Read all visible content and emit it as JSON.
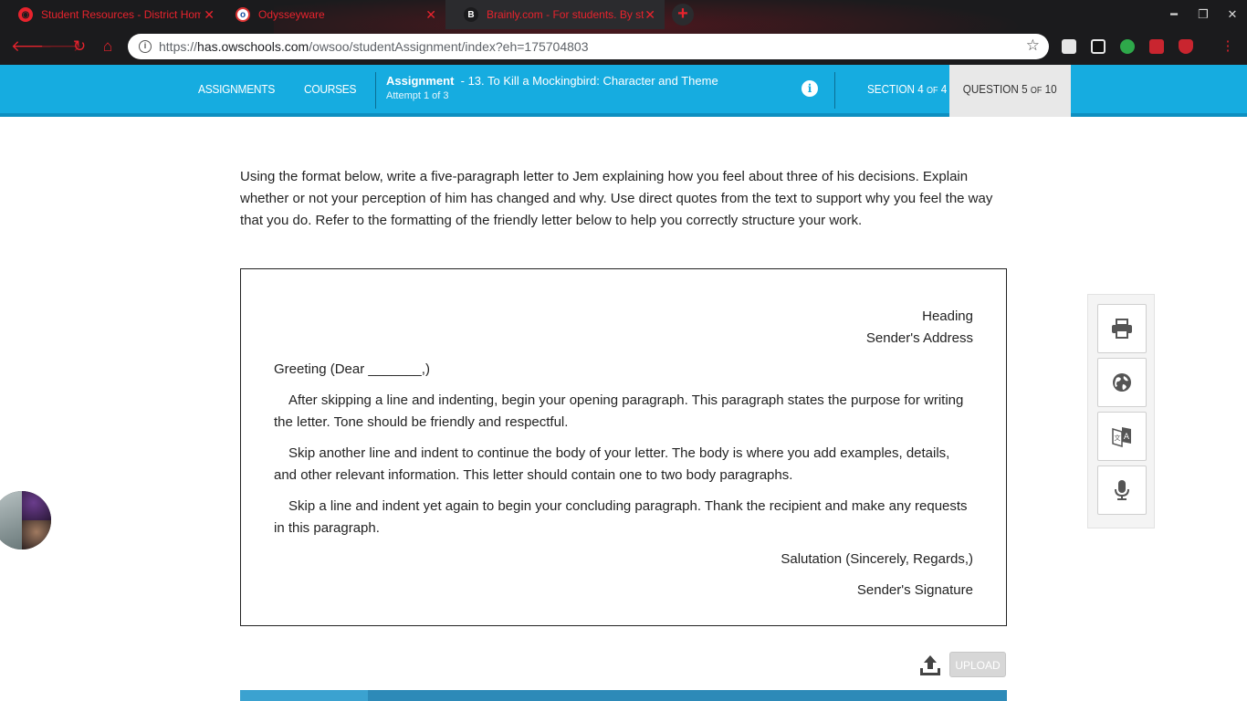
{
  "browser": {
    "tabs": [
      {
        "title": "Student Resources - District Hom",
        "favicon": "chrome-red-icon",
        "active": false
      },
      {
        "title": "Odysseyware",
        "favicon": "odysseyware-icon",
        "active": false
      },
      {
        "title": "Brainly.com - For students. By st",
        "favicon": "brainly-icon",
        "active": true
      }
    ],
    "url_scheme": "https://",
    "url_host": "has.owschools.com",
    "url_path": "/owsoo/studentAssignment/index?eh=175704803",
    "accent_color": "#e8232d"
  },
  "header": {
    "nav_assignments": "ASSIGNMENTS",
    "nav_courses": "COURSES",
    "assignment_label": "Assignment",
    "assignment_title": "- 13. To Kill a Mockingbird: Character and Theme",
    "attempt": "Attempt 1 of 3",
    "section_prefix": "SECTION 4",
    "section_of": "OF",
    "section_total": "4",
    "question_prefix": "QUESTION 5",
    "question_of": "OF",
    "question_total": "10",
    "bar_color": "#16ace0"
  },
  "content": {
    "prompt": "Using the format below, write a five-paragraph letter to Jem explaining how you feel about three of his decisions. Explain whether or not your perception of him has changed and why. Use direct quotes from the text to support why you feel the way that you do. Refer to the formatting of the friendly letter below to help you correctly structure your work.",
    "letter": {
      "heading": "Heading",
      "sender_address": "Sender's Address",
      "greeting": "Greeting (Dear _______,)",
      "para1": "After skipping a line and indenting, begin your opening paragraph. This paragraph states the purpose for writing the letter. Tone should be friendly and respectful.",
      "para2": "Skip another line and indent to continue the body of your letter. The body is where you add examples, details, and other relevant information. This letter should contain one to two body paragraphs.",
      "para3": "Skip a line and indent yet again to begin your concluding paragraph. Thank the recipient and make any requests in this paragraph.",
      "salutation": "Salutation (Sincerely, Regards,)",
      "signature": "Sender's Signature"
    }
  },
  "tools": [
    "print-icon",
    "globe-icon",
    "translate-icon",
    "microphone-icon"
  ],
  "upload": {
    "label": "UPLOAD"
  }
}
